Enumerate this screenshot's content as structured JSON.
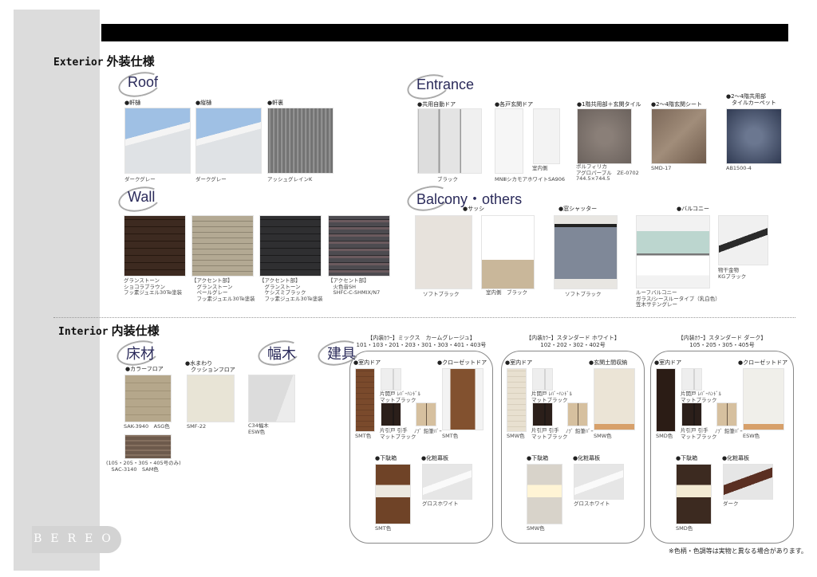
{
  "logo": "BEREO",
  "exterior": {
    "title_en": "Exterior",
    "title_ja": "外装仕様",
    "roof": {
      "heading": "Roof",
      "items": [
        {
          "label": "●軒樋",
          "caption": "ダークグレー"
        },
        {
          "label": "●縦樋",
          "caption": "ダークグレー"
        },
        {
          "label": "●軒裏",
          "caption": "アッシュグレインK"
        }
      ]
    },
    "entrance": {
      "heading": "Entrance",
      "items": [
        {
          "label": "●共用自動ドア",
          "caption": "ブラック"
        },
        {
          "label": "●各戸玄関ドア",
          "caption": "MNⅢシカモアホワイトSA906",
          "sub": "室内側"
        },
        {
          "label": "●1階共用部＋玄関タイル",
          "caption": "ポルフィリカ\nアグロパープル　ZE-0702\n744.5×744.5"
        },
        {
          "label": "●2～4階玄関シート",
          "caption": "SMD-17"
        },
        {
          "label": "●2～4階共用部\n　タイルカーペット",
          "caption": "AB1500-4"
        }
      ]
    },
    "wall": {
      "heading": "Wall",
      "items": [
        {
          "caption": "グランストーン\nショコラブラウン\nフッ素ジュエル30Te塗装"
        },
        {
          "caption": "【アクセント部】\n　グランストーン\n　ペールグレー\n　フッ素ジュエル30Te塗装"
        },
        {
          "caption": "【アクセント部】\n　グランストーン\n　ケシズミブラック\n　フッ素ジュエル30Te塗装"
        },
        {
          "caption": "【アクセント部】\n　火色音SH\n　SHFC-C-SHMIX/N7"
        }
      ]
    },
    "balcony": {
      "heading": "Balcony・others",
      "sash": {
        "label": "●サッシ",
        "captions": [
          "ソフトブラック",
          "室内側　ブラック"
        ]
      },
      "shutter": {
        "label": "●窓シャッター",
        "caption": "ソフトブラック"
      },
      "balcony": {
        "label": "●バルコニー",
        "caption": "ルーフバルコニー\nガラス/シースルータイプ（乳白色）\n笠木サテングレー",
        "hanger_caption": "物干金物\nKGブラック"
      }
    }
  },
  "interior": {
    "title_en": "Interior",
    "title_ja": "内装仕様",
    "floor": {
      "heading": "床材",
      "color_floor": {
        "label": "●カラーフロア",
        "caption": "SAK-3940　ASG色",
        "alt_caption": "(105・205・305・405号のみ)\n　SAC-3140　SAM色"
      },
      "cushion_floor": {
        "label": "●水まわり\n　クッションフロア",
        "caption": "SMF-22"
      }
    },
    "baseboard": {
      "heading": "幅木",
      "caption": "C34幅木\nESW色"
    },
    "fittings": {
      "heading": "建具",
      "groups": [
        {
          "header": "【内装ｶﾗｰ】ミックス　カームグレージュ】\n101・103・201・203・301・303・401・403号",
          "door_label": "●室内ドア",
          "door_caption": "SMT色",
          "handle_caption": "片開戸 ﾚﾊﾞｰﾊﾝﾄﾞﾙ\nマットブラック",
          "pull_caption": "片引戸 引手\nマットブラック",
          "knob_caption": "ﾉﾌﾞ 鉛筆ﾊﾞｰ",
          "storage_label": "●クローゼットドア",
          "storage_caption": "SMT色",
          "shoe_label": "●下駄箱",
          "shoe_caption": "SMT色",
          "board_label": "●化粧幕板",
          "board_caption": "グロスホワイト"
        },
        {
          "header": "【内装ｶﾗｰ】スタンダード ホワイト】\n102・202・302・402号",
          "door_label": "●室内ドア",
          "door_caption": "SMW色",
          "handle_caption": "片開戸 ﾚﾊﾞｰﾊﾝﾄﾞﾙ\nマットブラック",
          "pull_caption": "片引戸 引手\nマットブラック",
          "knob_caption": "ﾉﾌﾞ 鉛筆ﾊﾞｰ",
          "storage_label": "●玄関土間収納",
          "storage_caption": "SMW色",
          "shoe_label": "●下駄箱",
          "shoe_caption": "SMW色",
          "board_label": "●化粧幕板",
          "board_caption": "グロスホワイト"
        },
        {
          "header": "【内装ｶﾗｰ】スタンダード ダーク】\n105・205・305・405号",
          "door_label": "●室内ドア",
          "door_caption": "SMD色",
          "handle_caption": "片開戸 ﾚﾊﾞｰﾊﾝﾄﾞﾙ\nマットブラック",
          "pull_caption": "片引戸 引手\nマットブラック",
          "knob_caption": "ﾉﾌﾞ 鉛筆ﾊﾞｰ",
          "storage_label": "●クローゼットドア",
          "storage_caption": "ESW色",
          "shoe_label": "●下駄箱",
          "shoe_caption": "SMD色",
          "board_label": "●化粧幕板",
          "board_caption": "ダーク"
        }
      ]
    }
  },
  "footnote": "※色柄・色調等は実物と異なる場合があります。"
}
